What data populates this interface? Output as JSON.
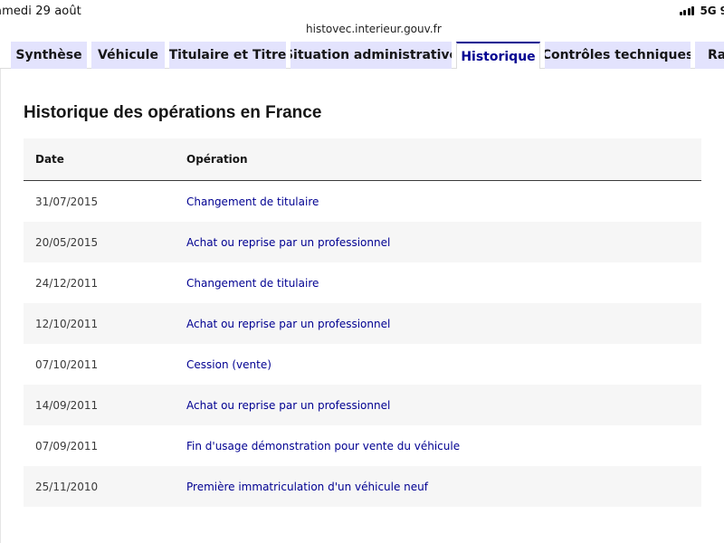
{
  "status_bar": {
    "date": "amedi 29 août",
    "url": "histovec.interieur.gouv.fr",
    "network": "5G",
    "battery": "9"
  },
  "tabs": [
    {
      "label": "Synthèse",
      "active": false
    },
    {
      "label": "Véhicule",
      "active": false
    },
    {
      "label": "Titulaire et Titre",
      "active": false
    },
    {
      "label": "Situation administrative",
      "active": false
    },
    {
      "label": "Historique",
      "active": true
    },
    {
      "label": "Contrôles techniques",
      "active": false
    },
    {
      "label": "Rap",
      "active": false
    }
  ],
  "main": {
    "title": "Historique des opérations en France",
    "table": {
      "headers": {
        "date": "Date",
        "operation": "Opération"
      },
      "rows": [
        {
          "date": "31/07/2015",
          "operation": "Changement de titulaire"
        },
        {
          "date": "20/05/2015",
          "operation": "Achat ou reprise par un professionnel"
        },
        {
          "date": "24/12/2011",
          "operation": "Changement de titulaire"
        },
        {
          "date": "12/10/2011",
          "operation": "Achat ou reprise par un professionnel"
        },
        {
          "date": "07/10/2011",
          "operation": "Cession (vente)"
        },
        {
          "date": "14/09/2011",
          "operation": "Achat ou reprise par un professionnel"
        },
        {
          "date": "07/09/2011",
          "operation": "Fin d'usage démonstration pour vente du véhicule"
        },
        {
          "date": "25/11/2010",
          "operation": "Première immatriculation d'un véhicule neuf"
        }
      ]
    }
  },
  "colors": {
    "accent": "#000091",
    "tab_bg": "#e3e3fd",
    "row_alt": "#f6f6f6"
  }
}
